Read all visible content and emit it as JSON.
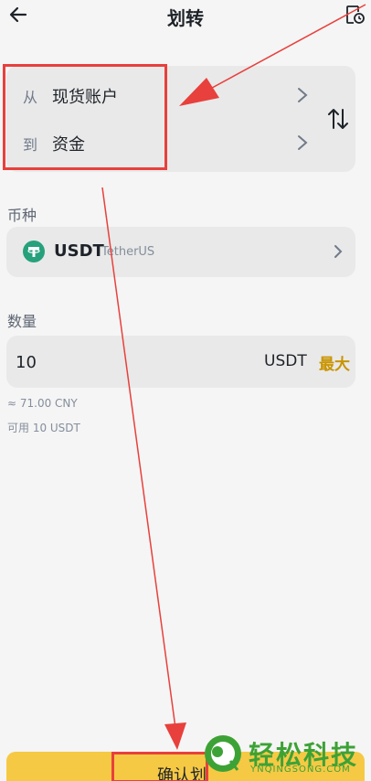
{
  "header": {
    "title": "划转"
  },
  "transfer": {
    "from_prefix": "从",
    "from_account": "现货账户",
    "to_prefix": "到",
    "to_account": "资金"
  },
  "coin": {
    "label": "币种",
    "symbol": "USDT",
    "name": "TetherUS"
  },
  "quantity": {
    "label": "数量",
    "value": "10",
    "unit": "USDT",
    "max_label": "最大",
    "cny_estimate": "≈ 71.00 CNY",
    "available": "可用 10 USDT"
  },
  "confirm": {
    "label": "确认划"
  },
  "watermark": {
    "text": "轻松科技",
    "subtext": "YNQINGSONG.COM"
  },
  "colors": {
    "accent": "#f6c944",
    "max": "#c99400",
    "annotation": "#e8403c",
    "coin_logo": "#26a17b",
    "watermark": "#3da236"
  },
  "icons": {
    "back": "arrow-left-icon",
    "history": "history-icon",
    "swap": "swap-vertical-icon",
    "chevron": "chevron-right-icon",
    "coin": "tether-logo-icon"
  }
}
